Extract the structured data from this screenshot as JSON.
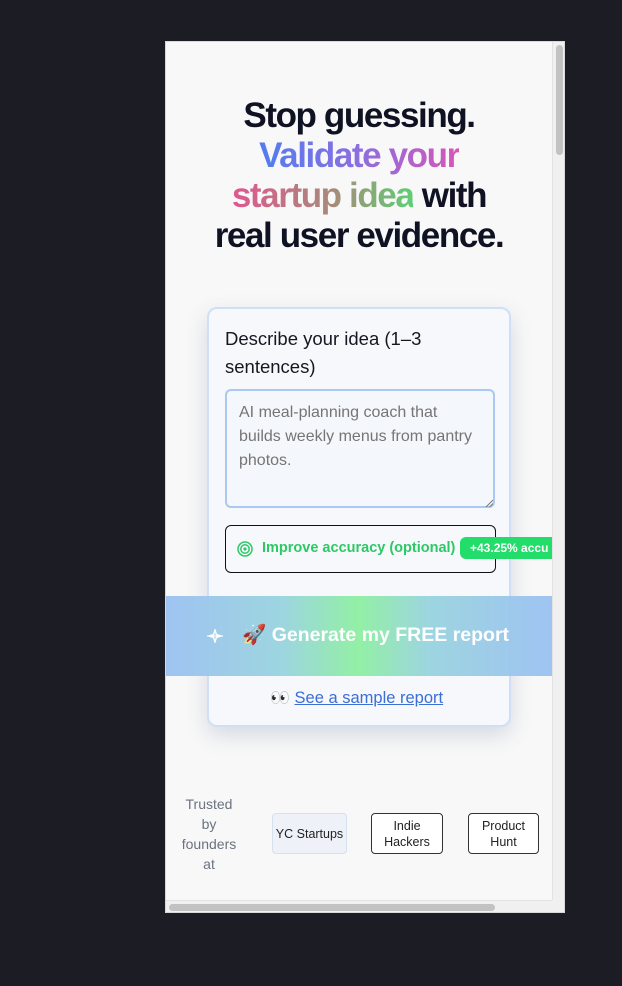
{
  "hero": {
    "line1": "Stop guessing.",
    "line2_gradient": "Validate your",
    "line3_gradient": "startup idea",
    "line3_plain": " with",
    "line4": "real user evidence."
  },
  "form": {
    "label": "Describe your idea (1–3 sentences)",
    "idea_placeholder": "AI meal-planning coach that builds weekly menus from pantry photos.",
    "idea_value": "",
    "accuracy_label": "Improve accuracy (optional)",
    "accuracy_badge": "+43.25% accu",
    "generate_label": "Generate my FREE report",
    "generate_emoji": "🚀",
    "sample_emoji": "👀",
    "sample_link": "See a sample report"
  },
  "trusted": {
    "label": "Trusted by founders at",
    "chips": [
      "YC Startups",
      "Indie Hackers",
      "Product Hunt"
    ]
  },
  "colors": {
    "accent_blue": "#4f7df0",
    "accent_green": "#22dd6a",
    "link": "#3b6fd6",
    "headline": "#0f1222"
  },
  "icons": {
    "accuracy": "target-icon",
    "generate_decor": "sparkle-icon"
  }
}
